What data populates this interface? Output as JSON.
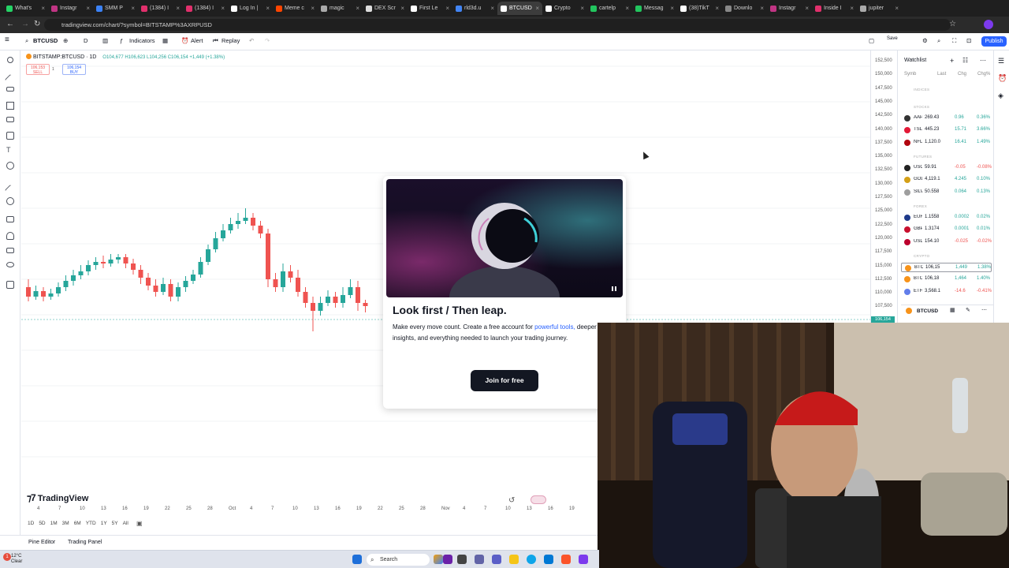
{
  "browser": {
    "tabs": [
      {
        "label": "What's",
        "color": "#25d366"
      },
      {
        "label": "Instagr",
        "color": "#c13584"
      },
      {
        "label": "SMM P",
        "color": "#3b82f6"
      },
      {
        "label": "(1384) I",
        "color": "#e1306c"
      },
      {
        "label": "(1384) I",
        "color": "#e1306c"
      },
      {
        "label": "Log In |",
        "color": "#ffffff"
      },
      {
        "label": "Meme c",
        "color": "#ff4500"
      },
      {
        "label": "magic",
        "color": "#aaaaaa"
      },
      {
        "label": "DEX Scr",
        "color": "#dddddd"
      },
      {
        "label": "First Le",
        "color": "#ffffff"
      },
      {
        "label": "rld3d.u",
        "color": "#4285f4"
      },
      {
        "label": "BTCUSD",
        "color": "#ffffff"
      },
      {
        "label": "Crypto",
        "color": "#ffffff"
      },
      {
        "label": "cartelp",
        "color": "#22c55e"
      },
      {
        "label": "Messag",
        "color": "#22c55e"
      },
      {
        "label": "(38)TikT",
        "color": "#ffffff"
      },
      {
        "label": "Downlo",
        "color": "#888888"
      },
      {
        "label": "Instagr",
        "color": "#c13584"
      },
      {
        "label": "Inside I",
        "color": "#e1306c"
      },
      {
        "label": "jupiter",
        "color": "#aaaaaa"
      }
    ],
    "url": "tradingview.com/chart/?symbol=BITSTAMP%3AXRPUSD"
  },
  "toolbar": {
    "symbol": "BTCUSD",
    "interval": "D",
    "indicators": "Indicators",
    "alert": "Alert",
    "replay": "Replay",
    "save_label": "Save",
    "publish": "Publish"
  },
  "legend": {
    "title": "BITSTAMP:BTCUSD · 1D",
    "ohlc": "O104,677 H106,623 L104,256 C106,154 +1,449 (+1.38%)",
    "sell_price": "106,153",
    "sell_label": "SELL",
    "buy_price": "106,154",
    "buy_label": "BUY",
    "spread": "1"
  },
  "chart_data": {
    "type": "candlestick",
    "price_ticks": [
      "152,500",
      "150,000",
      "147,500",
      "145,000",
      "142,500",
      "140,000",
      "137,500",
      "135,000",
      "132,500",
      "130,000",
      "127,500",
      "125,000",
      "122,500",
      "120,000",
      "117,500",
      "115,000",
      "112,500",
      "110,000",
      "107,500"
    ],
    "time_ticks": [
      "4",
      "7",
      "10",
      "13",
      "16",
      "19",
      "22",
      "25",
      "28",
      "Oct",
      "4",
      "7",
      "10",
      "13",
      "16",
      "19",
      "22",
      "25",
      "28",
      "Nov",
      "4",
      "7",
      "10",
      "13",
      "16",
      "19"
    ],
    "last_price": "106,154",
    "up_color": "#26a69a",
    "down_color": "#ef5350"
  },
  "bottom": {
    "logo": "TradingView",
    "ranges": [
      "1D",
      "5D",
      "1M",
      "3M",
      "6M",
      "YTD",
      "1Y",
      "5Y",
      "All"
    ],
    "pine_editor": "Pine Editor",
    "trading_panel": "Trading Panel"
  },
  "watchlist": {
    "title": "Watchlist",
    "columns": [
      "Symb",
      "Last",
      "Chg",
      "Chg%"
    ],
    "sections": {
      "indices": "INDICES",
      "stocks": "STOCKS",
      "futures": "FUTURES",
      "forex": "FOREX",
      "crypto": "CRYPTO"
    },
    "stocks": [
      {
        "symbol": "AAPL",
        "last": "269.43",
        "chg": "0.96",
        "pct": "0.36%",
        "color": "#333333",
        "sign": "up"
      },
      {
        "symbol": "TSLA",
        "last": "445.23",
        "chg": "15.71",
        "pct": "3.66%",
        "color": "#e31937",
        "sign": "up"
      },
      {
        "symbol": "NFLX",
        "last": "1,120.0",
        "chg": "16.41",
        "pct": "1.49%",
        "color": "#b1060f",
        "sign": "up"
      }
    ],
    "futures": [
      {
        "symbol": "USOIL",
        "last": "59.91",
        "chg": "-0.05",
        "pct": "-0.08%",
        "color": "#222222",
        "sign": "down"
      },
      {
        "symbol": "GOLD",
        "last": "4,119.1",
        "chg": "4.245",
        "pct": "0.10%",
        "color": "#d4a017",
        "sign": "up"
      },
      {
        "symbol": "SILVER",
        "last": "50.558",
        "chg": "0.064",
        "pct": "0.13%",
        "color": "#9e9e9e",
        "sign": "up"
      }
    ],
    "forex": [
      {
        "symbol": "EURUSD",
        "last": "1.1558",
        "chg": "0.0002",
        "pct": "0.02%",
        "color": "#1e3a8a",
        "sign": "up"
      },
      {
        "symbol": "GBPUSD",
        "last": "1.3174",
        "chg": "0.0001",
        "pct": "0.01%",
        "color": "#c8102e",
        "sign": "up"
      },
      {
        "symbol": "USDJPY",
        "last": "154.10",
        "chg": "-0.025",
        "pct": "-0.02%",
        "color": "#bc002d",
        "sign": "down"
      }
    ],
    "crypto": [
      {
        "symbol": "BTCUSD",
        "last": "106,15",
        "chg": "1,449",
        "pct": "1.38%",
        "color": "#f7931a",
        "sign": "up"
      },
      {
        "symbol": "BTCUSD",
        "last": "106,18",
        "chg": "1,464",
        "pct": "1.40%",
        "color": "#f7931a",
        "sign": "up"
      },
      {
        "symbol": "ETHUSD",
        "last": "3,568.1",
        "chg": "-14.6",
        "pct": "-0.41%",
        "color": "#627eea",
        "sign": "down"
      }
    ],
    "detail_symbol": "BTCUSD"
  },
  "modal": {
    "title": "Look first / Then leap.",
    "text_before_link": "Make every move count. Create a free account for ",
    "link": "powerful tools,",
    "text_after_link": " deeper insights, and everything needed to launch your trading journey.",
    "button": "Join for free"
  },
  "taskbar": {
    "temp": "12°C",
    "weather": "Clear",
    "search_placeholder": "Search",
    "notification_count": "1"
  }
}
